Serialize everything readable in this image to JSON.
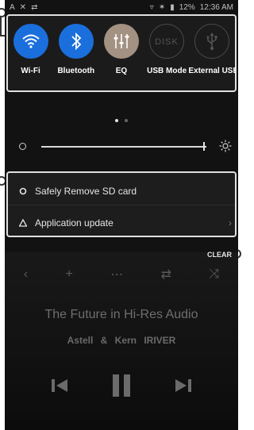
{
  "status_bar": {
    "battery": "12%",
    "time": "12:36 AM"
  },
  "quick_settings": [
    {
      "id": "wifi",
      "label": "Wi-Fi",
      "icon": "wifi-icon",
      "color": "#1a6fdc",
      "active": true
    },
    {
      "id": "bluetooth",
      "label": "Bluetooth",
      "icon": "bluetooth-icon",
      "color": "#1a6fdc",
      "active": true
    },
    {
      "id": "eq",
      "label": "EQ",
      "sub": "",
      "icon": "equalizer-icon",
      "color": "#a39182",
      "active": true
    },
    {
      "id": "usb_mode",
      "label": "USB Mode",
      "icon": "disk-icon",
      "active": false
    },
    {
      "id": "external_usb",
      "label": "External USB",
      "icon": "usb-icon",
      "active": false
    }
  ],
  "page_indicator": {
    "pages": 2,
    "current": 1
  },
  "brightness": {
    "level": 0.98
  },
  "notifications": [
    {
      "text": "Safely Remove SD card",
      "icon": "circle-icon"
    },
    {
      "text": "Application update",
      "icon": "warning-triangle-icon"
    }
  ],
  "clear_label": "CLEAR",
  "player": {
    "song_title": "The Future in Hi-Res Audio",
    "artists": "Astell & Kern IRIVER"
  },
  "colors": {
    "accent_blue": "#1a6fdc",
    "eq_tan": "#a39182"
  }
}
